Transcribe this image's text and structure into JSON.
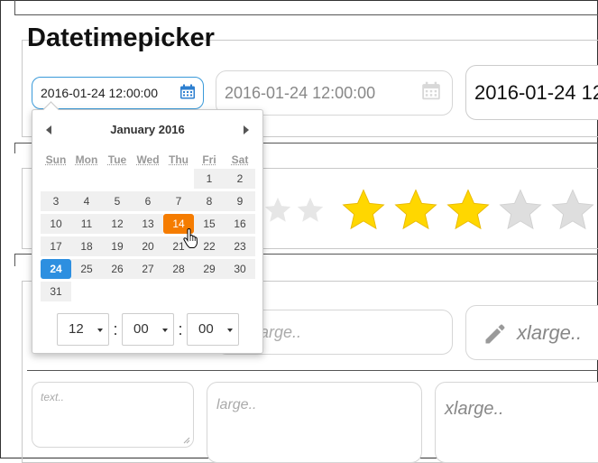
{
  "section": {
    "title": "Datetimepicker"
  },
  "datetime_inputs": [
    {
      "value": "2016-01-24 12:00:00",
      "state": "active",
      "icon": "calendar-icon",
      "color": "#2d7fd0"
    },
    {
      "value": "2016-01-24 12:00:00",
      "state": "disabled",
      "icon": "calendar-icon",
      "color": "#d8d8d8"
    },
    {
      "value": "2016-01-24 12",
      "state": "xlarge"
    }
  ],
  "rating": {
    "stars_total": 5,
    "stars_filled": 3,
    "filled_color": "#ffd700",
    "empty_color": "#e0e0e0"
  },
  "inputs_row": {
    "large_placeholder": "large..",
    "xlarge_placeholder": "xlarge..",
    "xlarge_icon": "pencil-icon"
  },
  "textareas": {
    "small_placeholder": "text..",
    "large_placeholder": "large..",
    "xlarge_placeholder": "xlarge.."
  },
  "calendar": {
    "month": "January",
    "year": "2016",
    "weekdays": [
      "Sun",
      "Mon",
      "Tue",
      "Wed",
      "Thu",
      "Fri",
      "Sat"
    ],
    "weeks": [
      [
        "",
        "",
        "",
        "",
        "",
        "1",
        "2"
      ],
      [
        "3",
        "4",
        "5",
        "6",
        "7",
        "8",
        "9"
      ],
      [
        "10",
        "11",
        "12",
        "13",
        "14",
        "15",
        "16"
      ],
      [
        "17",
        "18",
        "19",
        "20",
        "21",
        "22",
        "23"
      ],
      [
        "24",
        "25",
        "26",
        "27",
        "28",
        "29",
        "30"
      ],
      [
        "31",
        "",
        "",
        "",
        "",
        "",
        ""
      ]
    ],
    "today": "14",
    "selected": "24",
    "today_color": "#f57c00",
    "selected_color": "#2d8fe0",
    "time": {
      "hour": "12",
      "minute": "00",
      "second": "00",
      "separator": ":"
    }
  }
}
